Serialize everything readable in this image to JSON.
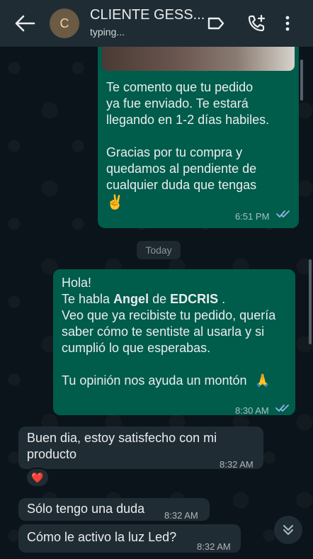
{
  "header": {
    "contact_name": "CLIENTE GESS...",
    "avatar_initial": "C",
    "status": "typing..."
  },
  "messages": {
    "m1": {
      "line1": "Te comento que tu pedido",
      "line2": "ya fue enviado. Te estará",
      "line3": "llegando en 1-2 días habiles.",
      "line4": "Gracias por tu compra y",
      "line5": "quedamos al pendiente de",
      "line6": "cualquier duda que tengas",
      "emoji": "✌️",
      "time": "6:51 PM"
    },
    "day_separator": "Today",
    "m2": {
      "line1": "Hola!",
      "line2_pre": "Te habla ",
      "line2_name": "Angel",
      "line2_mid": " de ",
      "line2_brand": "EDCRIS",
      "line2_post": " .",
      "line3": "Veo que ya recibiste tu pedido, quería",
      "line4": "saber cómo te sentiste al usarla y si",
      "line5": "cumplió lo que esperabas.",
      "line6": "Tu opinión nos ayuda un montón",
      "emoji": "🙏",
      "time": "8:30 AM"
    },
    "m3": {
      "line1": "Buen dia, estoy satisfecho con mi",
      "line2": "producto",
      "time": "8:32 AM",
      "reaction": "❤️"
    },
    "m4": {
      "text": "Sólo tengo una duda",
      "time": "8:32 AM"
    },
    "m5": {
      "text": "Cómo le activo la luz Led?",
      "time": "8:32 AM"
    }
  },
  "colors": {
    "header_bg": "#1f2c34",
    "outgoing_bubble": "#005c4b",
    "incoming_bubble": "#202c33",
    "read_ticks": "#8fb5e6"
  },
  "icons": [
    "back-arrow-icon",
    "label-icon",
    "add-call-icon",
    "more-vert-icon",
    "double-tick-icon",
    "chevron-double-down-icon"
  ]
}
